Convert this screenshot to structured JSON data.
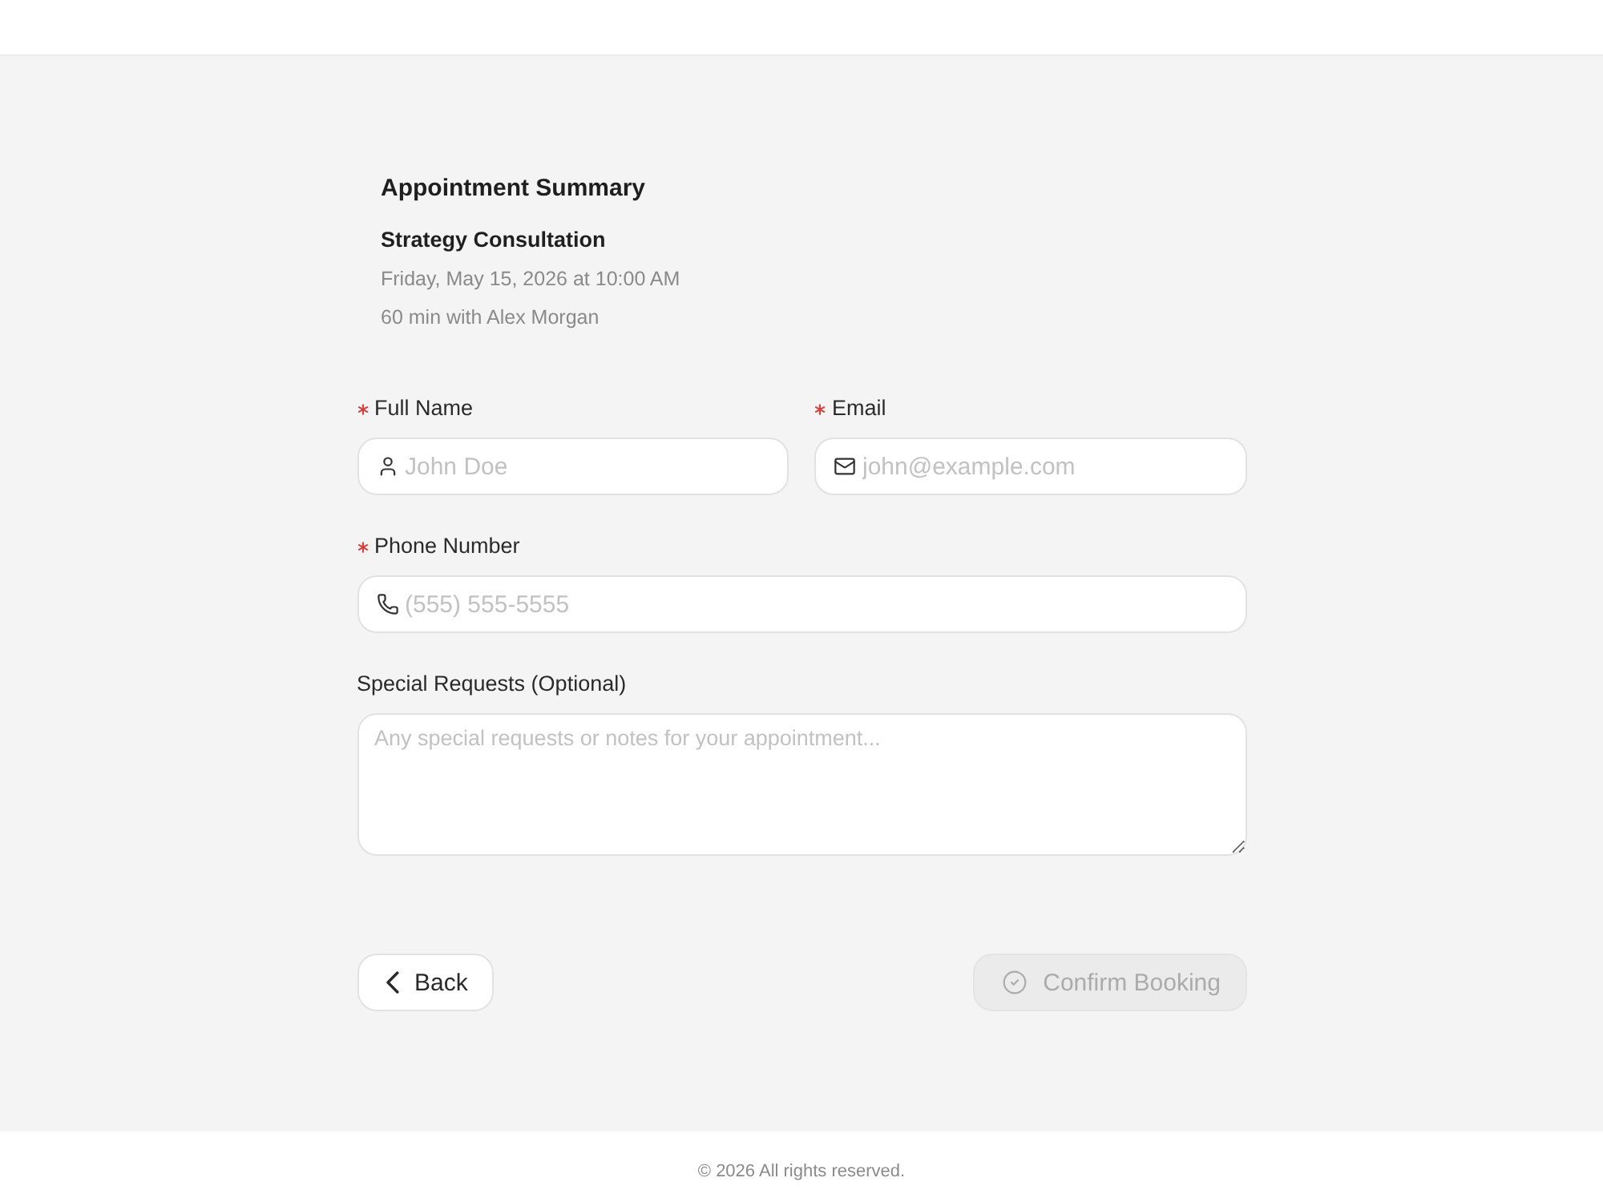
{
  "summary": {
    "title": "Appointment Summary",
    "service": "Strategy Consultation",
    "datetime": "Friday, May 15, 2026 at 10:00 AM",
    "details": "60 min with Alex Morgan"
  },
  "form": {
    "rows": [
      {
        "fields": [
          {
            "kind": "name",
            "label": "Full Name",
            "required": true,
            "placeholder": "John Doe"
          },
          {
            "kind": "email",
            "label": "Email",
            "required": true,
            "placeholder": "john@example.com"
          }
        ]
      },
      {
        "fields": [
          {
            "kind": "phone",
            "label": "Phone Number",
            "required": true,
            "placeholder": "(555) 555-5555"
          }
        ]
      },
      {
        "fields": [
          {
            "kind": "notes",
            "label": "Special Requests (Optional)",
            "required": false,
            "placeholder": "Any special requests or notes for your appointment..."
          }
        ]
      }
    ]
  },
  "actions": [
    {
      "kind": "back",
      "label": "Back",
      "disabled": false
    },
    {
      "kind": "confirm",
      "label": "Confirm Booking",
      "disabled": true
    }
  ],
  "footer": {
    "text": "© 2026 All rights reserved."
  }
}
